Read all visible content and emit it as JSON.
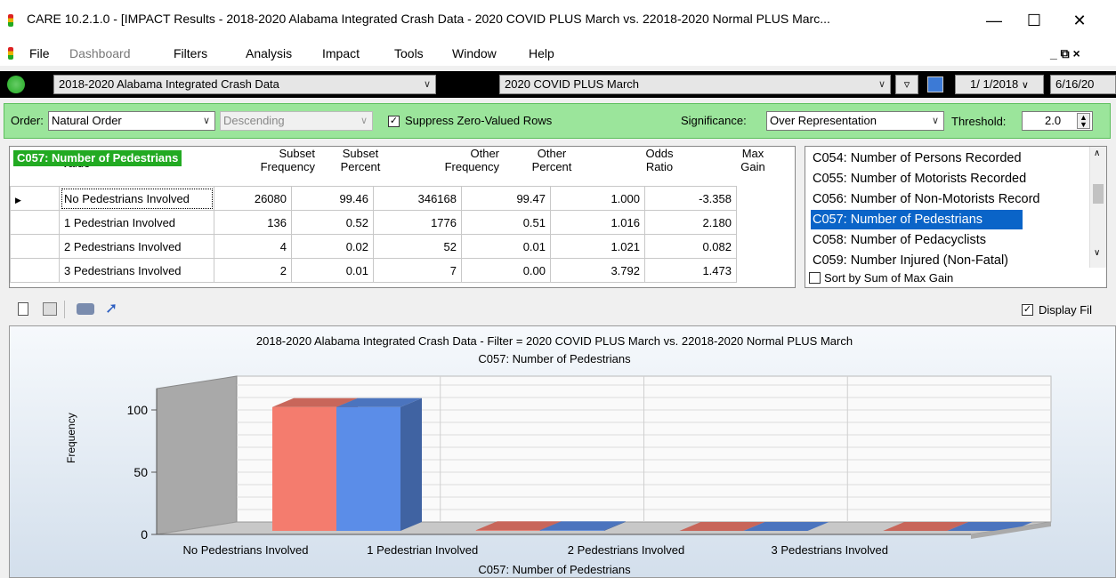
{
  "window": {
    "title": "CARE 10.2.1.0 - [IMPACT Results - 2018-2020 Alabama Integrated Crash Data - 2020 COVID PLUS March vs. 22018-2020 Normal PLUS Marc...",
    "minimize": "—",
    "maximize": "☐",
    "close": "✕"
  },
  "menu": {
    "items": [
      "File",
      "Dashboard",
      "Filters",
      "Analysis",
      "Impact",
      "Tools",
      "Window",
      "Help"
    ],
    "right_controls": "_ ⧉ ×"
  },
  "toolbar": {
    "dataset": "2018-2020 Alabama Integrated Crash Data",
    "filter": "2020 COVID PLUS March",
    "date_start": "1/ 1/2018",
    "date_end": "6/16/20"
  },
  "options": {
    "order_label": "Order:",
    "order_value": "Natural Order",
    "direction_value": "Descending",
    "suppress_label": "Suppress Zero-Valued Rows",
    "significance_label": "Significance:",
    "significance_value": "Over Representation",
    "threshold_label": "Threshold:",
    "threshold_value": "2.0"
  },
  "table": {
    "title_badge": "C057: Number of Pedestrians",
    "value_header": "Value",
    "headers": [
      "Subset Frequency",
      "Subset Percent",
      "Other Frequency",
      "Other Percent",
      "Odds Ratio",
      "Max Gain"
    ],
    "header_lines": [
      [
        "Subset",
        "Frequency"
      ],
      [
        "Subset",
        "Percent"
      ],
      [
        "Other",
        "Frequency"
      ],
      [
        "Other",
        "Percent"
      ],
      [
        "Odds",
        "Ratio"
      ],
      [
        "Max",
        "Gain"
      ]
    ],
    "rows": [
      {
        "value": "No Pedestrians Involved",
        "subset_freq": "26080",
        "subset_pct": "99.46",
        "other_freq": "346168",
        "other_pct": "99.47",
        "odds": "1.000",
        "gain": "-3.358"
      },
      {
        "value": "1 Pedestrian Involved",
        "subset_freq": "136",
        "subset_pct": "0.52",
        "other_freq": "1776",
        "other_pct": "0.51",
        "odds": "1.016",
        "gain": "2.180"
      },
      {
        "value": "2 Pedestrians Involved",
        "subset_freq": "4",
        "subset_pct": "0.02",
        "other_freq": "52",
        "other_pct": "0.01",
        "odds": "1.021",
        "gain": "0.082"
      },
      {
        "value": "3 Pedestrians Involved",
        "subset_freq": "2",
        "subset_pct": "0.01",
        "other_freq": "7",
        "other_pct": "0.00",
        "odds": "3.792",
        "gain": "1.473"
      }
    ]
  },
  "attribute_list": {
    "items": [
      "C054: Number of Persons Recorded",
      "C055: Number of Motorists Recorded",
      "C056: Number of Non-Motorists Record",
      "C057: Number of Pedestrians",
      "C058: Number of Pedacyclists",
      "C059: Number Injured (Non-Fatal)"
    ],
    "selected_index": 3,
    "sort_label": "Sort by Sum of Max Gain"
  },
  "chart_toolbar": {
    "display_filter_label": "Display Fil"
  },
  "chart_data": {
    "type": "bar",
    "title": "2018-2020 Alabama Integrated Crash Data - Filter = 2020 COVID PLUS March vs. 22018-2020 Normal PLUS March",
    "subtitle": "C057: Number of Pedestrians",
    "xlabel": "C057: Number of Pedestrians",
    "ylabel": "Frequency",
    "categories": [
      "No Pedestrians Involved",
      "1 Pedestrian Involved",
      "2 Pedestrians Involved",
      "3 Pedestrians Involved"
    ],
    "series": [
      {
        "values": [
          99.46,
          0.52,
          0.02,
          0.01
        ],
        "color": "#f47c6e"
      },
      {
        "values": [
          99.47,
          0.51,
          0.01,
          0.0
        ],
        "color": "#5b8de8"
      }
    ],
    "ylim": [
      0,
      110
    ],
    "yticks": [
      "0",
      "50",
      "100"
    ],
    "grid": true
  }
}
